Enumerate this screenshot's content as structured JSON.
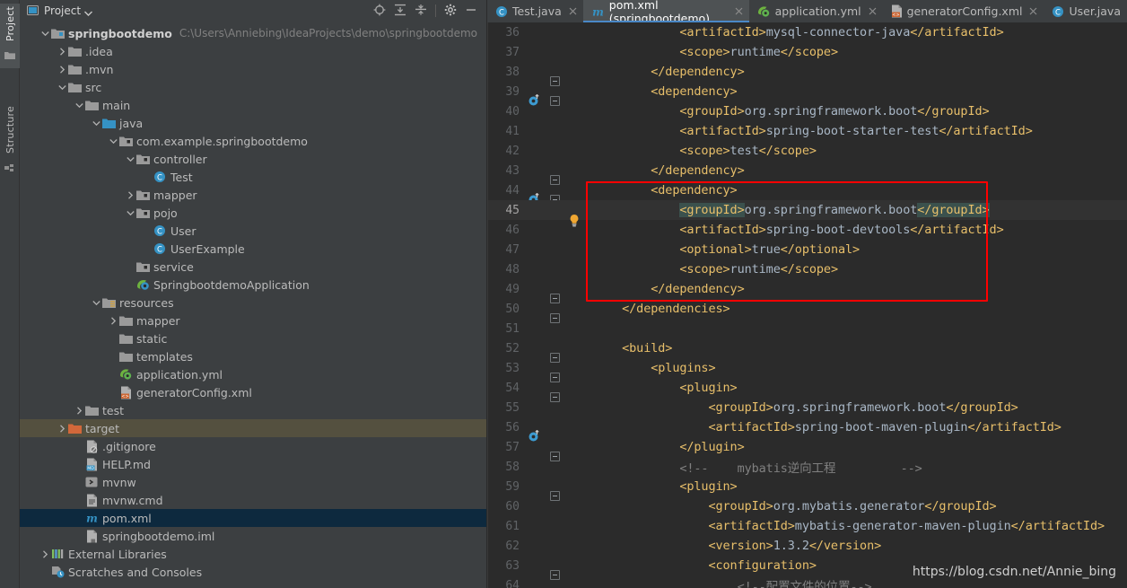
{
  "toolwindows": [
    {
      "label": "Project",
      "icon": "folder-icon",
      "active": true
    },
    {
      "label": "Structure",
      "icon": "structure-icon",
      "active": false
    }
  ],
  "panel": {
    "title": "Project",
    "dropdown_icon": "chevron-down-icon",
    "header_icons": [
      "locate-icon",
      "expand-all-icon",
      "collapse-all-icon",
      "settings-gear-icon",
      "hide-minimize-icon"
    ]
  },
  "tree": [
    {
      "depth": 0,
      "arrow": "down",
      "icon": "module-folder-icon",
      "label": "springbootdemo",
      "bold": true,
      "sub": "C:\\Users\\Anniebing\\IdeaProjects\\demo\\springbootdemo",
      "state": "none"
    },
    {
      "depth": 1,
      "arrow": "right",
      "icon": "folder-icon",
      "label": ".idea",
      "bold": false,
      "sub": "",
      "state": "none"
    },
    {
      "depth": 1,
      "arrow": "right",
      "icon": "folder-icon",
      "label": ".mvn",
      "bold": false,
      "sub": "",
      "state": "none"
    },
    {
      "depth": 1,
      "arrow": "down",
      "icon": "folder-icon",
      "label": "src",
      "bold": false,
      "sub": "",
      "state": "none"
    },
    {
      "depth": 2,
      "arrow": "down",
      "icon": "folder-icon",
      "label": "main",
      "bold": false,
      "sub": "",
      "state": "none"
    },
    {
      "depth": 3,
      "arrow": "down",
      "icon": "source-root-icon",
      "label": "java",
      "bold": false,
      "sub": "",
      "state": "none"
    },
    {
      "depth": 4,
      "arrow": "down",
      "icon": "package-icon",
      "label": "com.example.springbootdemo",
      "bold": false,
      "sub": "",
      "state": "none"
    },
    {
      "depth": 5,
      "arrow": "down",
      "icon": "package-icon",
      "label": "controller",
      "bold": false,
      "sub": "",
      "state": "none"
    },
    {
      "depth": 6,
      "arrow": "none",
      "icon": "java-class-icon",
      "label": "Test",
      "bold": false,
      "sub": "",
      "state": "none"
    },
    {
      "depth": 5,
      "arrow": "right",
      "icon": "package-icon",
      "label": "mapper",
      "bold": false,
      "sub": "",
      "state": "none"
    },
    {
      "depth": 5,
      "arrow": "down",
      "icon": "package-icon",
      "label": "pojo",
      "bold": false,
      "sub": "",
      "state": "none"
    },
    {
      "depth": 6,
      "arrow": "none",
      "icon": "java-class-icon",
      "label": "User",
      "bold": false,
      "sub": "",
      "state": "none"
    },
    {
      "depth": 6,
      "arrow": "none",
      "icon": "java-class-icon",
      "label": "UserExample",
      "bold": false,
      "sub": "",
      "state": "none"
    },
    {
      "depth": 5,
      "arrow": "none",
      "icon": "package-icon",
      "label": "service",
      "bold": false,
      "sub": "",
      "state": "none"
    },
    {
      "depth": 5,
      "arrow": "none",
      "icon": "spring-class-icon",
      "label": "SpringbootdemoApplication",
      "bold": false,
      "sub": "",
      "state": "none"
    },
    {
      "depth": 3,
      "arrow": "down",
      "icon": "resource-root-icon",
      "label": "resources",
      "bold": false,
      "sub": "",
      "state": "none"
    },
    {
      "depth": 4,
      "arrow": "right",
      "icon": "folder-icon",
      "label": "mapper",
      "bold": false,
      "sub": "",
      "state": "none"
    },
    {
      "depth": 4,
      "arrow": "none",
      "icon": "folder-icon",
      "label": "static",
      "bold": false,
      "sub": "",
      "state": "none"
    },
    {
      "depth": 4,
      "arrow": "none",
      "icon": "folder-icon",
      "label": "templates",
      "bold": false,
      "sub": "",
      "state": "none"
    },
    {
      "depth": 4,
      "arrow": "none",
      "icon": "yml-spring-icon",
      "label": "application.yml",
      "bold": false,
      "sub": "",
      "state": "none"
    },
    {
      "depth": 4,
      "arrow": "none",
      "icon": "xml-file-icon",
      "label": "generatorConfig.xml",
      "bold": false,
      "sub": "",
      "state": "none"
    },
    {
      "depth": 2,
      "arrow": "right",
      "icon": "folder-icon",
      "label": "test",
      "bold": false,
      "sub": "",
      "state": "none"
    },
    {
      "depth": 1,
      "arrow": "right",
      "icon": "target-folder-icon",
      "label": "target",
      "bold": false,
      "sub": "",
      "state": "target"
    },
    {
      "depth": 2,
      "arrow": "none",
      "icon": "gitignore-file-icon",
      "label": ".gitignore",
      "bold": false,
      "sub": "",
      "state": "none"
    },
    {
      "depth": 2,
      "arrow": "none",
      "icon": "markdown-file-icon",
      "label": "HELP.md",
      "bold": false,
      "sub": "",
      "state": "none"
    },
    {
      "depth": 2,
      "arrow": "none",
      "icon": "shell-script-icon",
      "label": "mvnw",
      "bold": false,
      "sub": "",
      "state": "none"
    },
    {
      "depth": 2,
      "arrow": "none",
      "icon": "cmd-file-icon",
      "label": "mvnw.cmd",
      "bold": false,
      "sub": "",
      "state": "none"
    },
    {
      "depth": 2,
      "arrow": "none",
      "icon": "maven-pom-icon",
      "label": "pom.xml",
      "bold": false,
      "sub": "",
      "state": "selected"
    },
    {
      "depth": 2,
      "arrow": "none",
      "icon": "iml-file-icon",
      "label": "springbootdemo.iml",
      "bold": false,
      "sub": "",
      "state": "none"
    },
    {
      "depth": 0,
      "arrow": "right",
      "icon": "external-libraries-icon",
      "label": "External Libraries",
      "bold": false,
      "sub": "",
      "state": "none"
    },
    {
      "depth": 0,
      "arrow": "none",
      "icon": "scratches-icon",
      "label": "Scratches and Consoles",
      "bold": false,
      "sub": "",
      "state": "none"
    }
  ],
  "tabs": [
    {
      "label": "Test.java",
      "icon": "java-class-icon",
      "active": false,
      "close_icon": "close-icon"
    },
    {
      "label": "pom.xml (springbootdemo)",
      "icon": "maven-pom-icon",
      "active": true,
      "close_icon": "close-icon"
    },
    {
      "label": "application.yml",
      "icon": "yml-spring-icon",
      "active": false,
      "close_icon": "close-icon"
    },
    {
      "label": "generatorConfig.xml",
      "icon": "xml-file-icon",
      "active": false,
      "close_icon": "close-icon"
    },
    {
      "label": "User.java",
      "icon": "java-class-icon",
      "active": false,
      "close_icon": ""
    }
  ],
  "editor": {
    "first_line": 36,
    "current_line": 45,
    "lines": [
      {
        "n": 36,
        "indent": 12,
        "tokens": [
          {
            "t": "tag",
            "v": "<artifactId>"
          },
          {
            "t": "txt",
            "v": "mysql-connector-java"
          },
          {
            "t": "tag",
            "v": "</artifactId>"
          }
        ],
        "gutter": "",
        "fold": "none",
        "bulb": false
      },
      {
        "n": 37,
        "indent": 12,
        "tokens": [
          {
            "t": "tag",
            "v": "<scope>"
          },
          {
            "t": "txt",
            "v": "runtime"
          },
          {
            "t": "tag",
            "v": "</scope>"
          }
        ],
        "gutter": "",
        "fold": "none",
        "bulb": false
      },
      {
        "n": 38,
        "indent": 8,
        "tokens": [
          {
            "t": "tag",
            "v": "</dependency>"
          }
        ],
        "gutter": "",
        "fold": "end",
        "bulb": false
      },
      {
        "n": 39,
        "indent": 8,
        "tokens": [
          {
            "t": "tag",
            "v": "<dependency>"
          }
        ],
        "gutter": "maven-dependency-icon",
        "fold": "start",
        "bulb": false
      },
      {
        "n": 40,
        "indent": 12,
        "tokens": [
          {
            "t": "tag",
            "v": "<groupId>"
          },
          {
            "t": "txt",
            "v": "org.springframework.boot"
          },
          {
            "t": "tag",
            "v": "</groupId>"
          }
        ],
        "gutter": "",
        "fold": "mid",
        "bulb": false
      },
      {
        "n": 41,
        "indent": 12,
        "tokens": [
          {
            "t": "tag",
            "v": "<artifactId>"
          },
          {
            "t": "txt",
            "v": "spring-boot-starter-test"
          },
          {
            "t": "tag",
            "v": "</artifactId>"
          }
        ],
        "gutter": "",
        "fold": "mid",
        "bulb": false
      },
      {
        "n": 42,
        "indent": 12,
        "tokens": [
          {
            "t": "tag",
            "v": "<scope>"
          },
          {
            "t": "txt",
            "v": "test"
          },
          {
            "t": "tag",
            "v": "</scope>"
          }
        ],
        "gutter": "",
        "fold": "mid",
        "bulb": false
      },
      {
        "n": 43,
        "indent": 8,
        "tokens": [
          {
            "t": "tag",
            "v": "</dependency>"
          }
        ],
        "gutter": "",
        "fold": "end",
        "bulb": false
      },
      {
        "n": 44,
        "indent": 8,
        "tokens": [
          {
            "t": "tag",
            "v": "<dependency>"
          }
        ],
        "gutter": "maven-dependency-icon",
        "fold": "start",
        "bulb": false
      },
      {
        "n": 45,
        "indent": 12,
        "tokens": [
          {
            "t": "tag-sel",
            "v": "<groupId>"
          },
          {
            "t": "txt",
            "v": "org.springframework.boot"
          },
          {
            "t": "tag-sel",
            "v": "</groupId>"
          }
        ],
        "gutter": "",
        "fold": "mid",
        "bulb": true
      },
      {
        "n": 46,
        "indent": 12,
        "tokens": [
          {
            "t": "tag",
            "v": "<artifactId>"
          },
          {
            "t": "txt",
            "v": "spring-boot-devtools"
          },
          {
            "t": "tag",
            "v": "</artifactId>"
          }
        ],
        "gutter": "",
        "fold": "mid",
        "bulb": false
      },
      {
        "n": 47,
        "indent": 12,
        "tokens": [
          {
            "t": "tag",
            "v": "<optional>"
          },
          {
            "t": "txt",
            "v": "true"
          },
          {
            "t": "tag",
            "v": "</optional>"
          }
        ],
        "gutter": "",
        "fold": "mid",
        "bulb": false
      },
      {
        "n": 48,
        "indent": 12,
        "tokens": [
          {
            "t": "tag",
            "v": "<scope>"
          },
          {
            "t": "txt",
            "v": "runtime"
          },
          {
            "t": "tag",
            "v": "</scope>"
          }
        ],
        "gutter": "",
        "fold": "mid",
        "bulb": false
      },
      {
        "n": 49,
        "indent": 8,
        "tokens": [
          {
            "t": "tag",
            "v": "</dependency>"
          }
        ],
        "gutter": "",
        "fold": "end",
        "bulb": false
      },
      {
        "n": 50,
        "indent": 4,
        "tokens": [
          {
            "t": "tag",
            "v": "</dependencies>"
          }
        ],
        "gutter": "",
        "fold": "end",
        "bulb": false
      },
      {
        "n": 51,
        "indent": 0,
        "tokens": [],
        "gutter": "",
        "fold": "none",
        "bulb": false
      },
      {
        "n": 52,
        "indent": 4,
        "tokens": [
          {
            "t": "tag",
            "v": "<build>"
          }
        ],
        "gutter": "",
        "fold": "start",
        "bulb": false
      },
      {
        "n": 53,
        "indent": 8,
        "tokens": [
          {
            "t": "tag",
            "v": "<plugins>"
          }
        ],
        "gutter": "",
        "fold": "start",
        "bulb": false
      },
      {
        "n": 54,
        "indent": 12,
        "tokens": [
          {
            "t": "tag",
            "v": "<plugin>"
          }
        ],
        "gutter": "",
        "fold": "start",
        "bulb": false
      },
      {
        "n": 55,
        "indent": 16,
        "tokens": [
          {
            "t": "tag",
            "v": "<groupId>"
          },
          {
            "t": "txt",
            "v": "org.springframework.boot"
          },
          {
            "t": "tag",
            "v": "</groupId>"
          }
        ],
        "gutter": "",
        "fold": "mid",
        "bulb": false
      },
      {
        "n": 56,
        "indent": 16,
        "tokens": [
          {
            "t": "tag",
            "v": "<artifactId>"
          },
          {
            "t": "txt",
            "v": "spring-boot-maven-plugin"
          },
          {
            "t": "tag",
            "v": "</artifactId>"
          }
        ],
        "gutter": "maven-dependency-icon",
        "fold": "mid",
        "bulb": false
      },
      {
        "n": 57,
        "indent": 12,
        "tokens": [
          {
            "t": "tag",
            "v": "</plugin>"
          }
        ],
        "gutter": "",
        "fold": "end",
        "bulb": false
      },
      {
        "n": 58,
        "indent": 12,
        "tokens": [
          {
            "t": "cmt",
            "v": "<!--    mybatis逆向工程         -->"
          }
        ],
        "gutter": "",
        "fold": "none",
        "bulb": false
      },
      {
        "n": 59,
        "indent": 12,
        "tokens": [
          {
            "t": "tag",
            "v": "<plugin>"
          }
        ],
        "gutter": "",
        "fold": "start",
        "bulb": false
      },
      {
        "n": 60,
        "indent": 16,
        "tokens": [
          {
            "t": "tag",
            "v": "<groupId>"
          },
          {
            "t": "txt",
            "v": "org.mybatis.generator"
          },
          {
            "t": "tag",
            "v": "</groupId>"
          }
        ],
        "gutter": "",
        "fold": "mid",
        "bulb": false
      },
      {
        "n": 61,
        "indent": 16,
        "tokens": [
          {
            "t": "tag",
            "v": "<artifactId>"
          },
          {
            "t": "txt",
            "v": "mybatis-generator-maven-plugin"
          },
          {
            "t": "tag",
            "v": "</artifactId>"
          }
        ],
        "gutter": "",
        "fold": "mid",
        "bulb": false
      },
      {
        "n": 62,
        "indent": 16,
        "tokens": [
          {
            "t": "tag",
            "v": "<version>"
          },
          {
            "t": "txt",
            "v": "1.3.2"
          },
          {
            "t": "tag",
            "v": "</version>"
          }
        ],
        "gutter": "",
        "fold": "mid",
        "bulb": false
      },
      {
        "n": 63,
        "indent": 16,
        "tokens": [
          {
            "t": "tag",
            "v": "<configuration>"
          }
        ],
        "gutter": "",
        "fold": "start",
        "bulb": false
      },
      {
        "n": 64,
        "indent": 20,
        "tokens": [
          {
            "t": "cmt",
            "v": "<!--配置文件的位置-->"
          }
        ],
        "gutter": "",
        "fold": "mid",
        "bulb": false
      }
    ]
  },
  "annotation": {
    "redbox_label": "highlighted-devtools-dependency"
  },
  "watermark": "https://blog.csdn.net/Annie_bing",
  "colors": {
    "accent_blue": "#4a88c7",
    "tag_gold": "#e8bf6a",
    "text_blue_grey": "#a9b7c6",
    "comment_grey": "#808080",
    "selection_teal": "#3b514d",
    "highlight_red": "#ff0000",
    "panel_bg": "#3c3f41",
    "editor_bg": "#2b2b2b"
  }
}
